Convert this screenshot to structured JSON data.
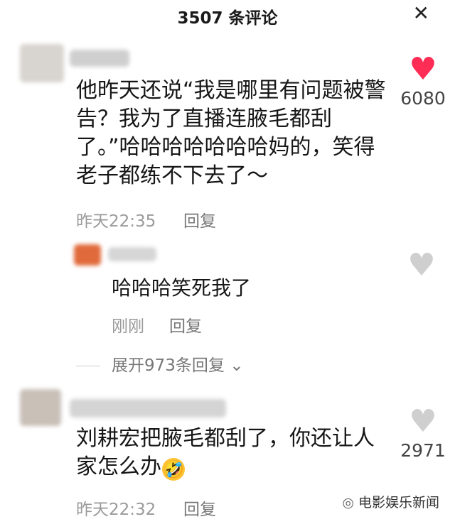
{
  "header": {
    "title": "3507 条评论",
    "close_symbol": "✕"
  },
  "comments": [
    {
      "text_lines": [
        "他昨天还说“我是哪里有问题被警",
        "告？我为了直播连腋毛都刮",
        "了。”哈哈哈哈哈哈哈妈的，笑得",
        "老子都练不下去了～"
      ],
      "time": "昨天22:35",
      "reply_label": "回复",
      "likes": "6080",
      "liked": true
    },
    {
      "text": "哈哈哈笑死我了",
      "time": "刚刚",
      "reply_label": "回复",
      "liked": false
    },
    {
      "text_lines": [
        "刘耕宏把腋毛都刮了，你还让人",
        "家怎么办"
      ],
      "emoji": "🤣",
      "time": "昨天22:32",
      "reply_label": "回复",
      "likes": "2971",
      "liked": false
    }
  ],
  "expand_replies": "展开973条回复",
  "watermark": "电影娱乐新闻",
  "colors": {
    "like_active": "#ff2d55",
    "like_inactive": "#cfcfcf"
  }
}
